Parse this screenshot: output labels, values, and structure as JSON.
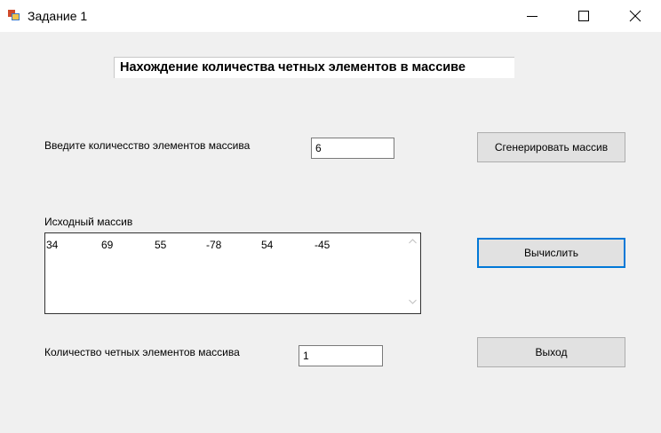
{
  "window": {
    "title": "Задание 1"
  },
  "heading": "Нахождение количества четных элементов в массиве",
  "input_count": {
    "label": "Введите количесство элементов массива",
    "value": "6"
  },
  "generate_button": "Сгенерировать массив",
  "source_array": {
    "label": "Исходный массив",
    "values": [
      "34",
      "69",
      "55",
      "-78",
      "54",
      "-45"
    ]
  },
  "calculate_button": "Вычислить",
  "even_count": {
    "label": "Количество четных элементов массива",
    "value": "1"
  },
  "exit_button": "Выход",
  "colors": {
    "focus_border": "#0078d7",
    "form_background": "#f0f0f0",
    "button_face": "#e1e1e1"
  }
}
